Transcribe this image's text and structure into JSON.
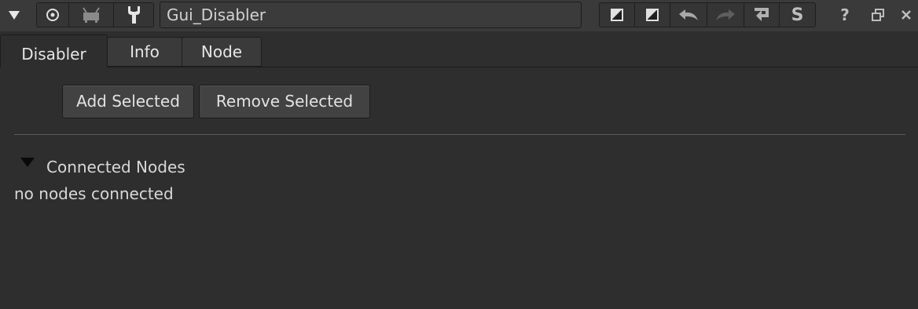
{
  "toolbar": {
    "node_name": "Gui_Disabler",
    "icons": {
      "collapse": "triangle-down-icon",
      "center": "target-icon",
      "viewer": "viewer-icon",
      "settings": "wrench-icon",
      "default1": "split-square-icon",
      "default2": "split-square-icon",
      "undo": "undo-icon",
      "redo": "redo-icon",
      "revert": "revert-icon",
      "help": "help-icon",
      "float": "float-window-icon"
    },
    "s_label": "S",
    "help_label": "?"
  },
  "tabs": [
    {
      "label": "Disabler",
      "active": true
    },
    {
      "label": "Info",
      "active": false
    },
    {
      "label": "Node",
      "active": false
    }
  ],
  "buttons": {
    "add": "Add Selected",
    "remove": "Remove Selected"
  },
  "section": {
    "title": "Connected Nodes",
    "empty_text": "no nodes connected"
  },
  "colors": {
    "background": "#2e2e2e",
    "toolbar": "#3a3a3a",
    "button": "#424242"
  }
}
